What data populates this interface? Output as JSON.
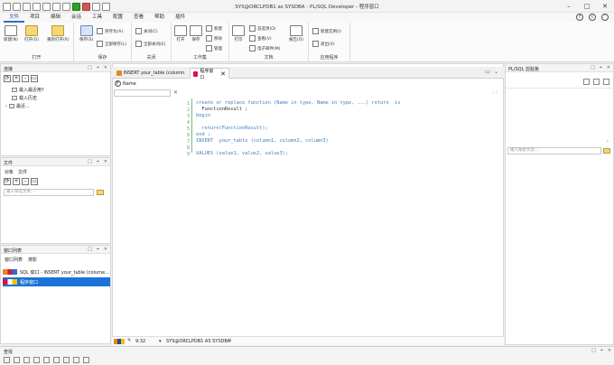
{
  "window": {
    "title": "SYS@ORCLPDB1 as SYSDBA - PL/SQL Developer - 程序窗口"
  },
  "menu": [
    "文件",
    "项目",
    "编辑",
    "会话",
    "工具",
    "配置",
    "查看",
    "帮助",
    "插件"
  ],
  "ribbon": {
    "groups": [
      {
        "label": "打开",
        "buttons": [
          "新建(N)",
          "打开(O)",
          "重新打开(R)"
        ]
      },
      {
        "label": "保存",
        "buttons": [
          "保存(S)",
          "另存为(A)",
          "全部保存(L)"
        ]
      },
      {
        "label": "关闭",
        "buttons": [
          "关闭(C)",
          "全部关闭(E)"
        ]
      },
      {
        "label": "工作集",
        "buttons": [
          "打开",
          "保存",
          "新建",
          "移除",
          "管理"
        ]
      },
      {
        "label": "文档",
        "buttons": [
          "打印",
          "首选项(O)",
          "查看(V)",
          "电子邮件(M)",
          "报告(O)"
        ]
      },
      {
        "label": "应用程序",
        "buttons": [
          "新建实例(I)",
          "退出(X)"
        ]
      }
    ]
  },
  "connections": {
    "title": "连接",
    "items": [
      "最入最近用?",
      "载入历史",
      "最近..."
    ]
  },
  "files": {
    "title": "文件",
    "tabs": [
      "对象",
      "文件"
    ],
    "search_placeholder": "输入筛选文本..."
  },
  "window_list": {
    "title": "窗口列表",
    "tabs": [
      "窗口列表",
      "排影"
    ],
    "items": [
      "SQL 窗口 - INSERT  your_table (colume...",
      "程序窗口"
    ]
  },
  "editor": {
    "tabs": [
      "INSERT  your_table (column...",
      "程序窗口"
    ],
    "name_label": "Name",
    "code": [
      "create or replace function (Name in type, Name in type, ...) return  is",
      "  FunctionResult ;",
      "begin",
      "",
      "  return(FunctionResult);",
      "end ;",
      "INSERT  your_table (column1, column2, column3)",
      "",
      "VALUES (value1, value2, value3);"
    ],
    "line_numbers": [
      "1",
      "2",
      "3",
      "4",
      "5",
      "6",
      "7",
      "8",
      "9"
    ]
  },
  "status": {
    "position": "9:32",
    "connection": "SYS@ORCLPDB1 AS SYSDBA"
  },
  "clipboard": {
    "title": "PL/SQL 剪贴板",
    "search_placeholder": "输入搜索文段..."
  },
  "find": {
    "title": "查找"
  }
}
